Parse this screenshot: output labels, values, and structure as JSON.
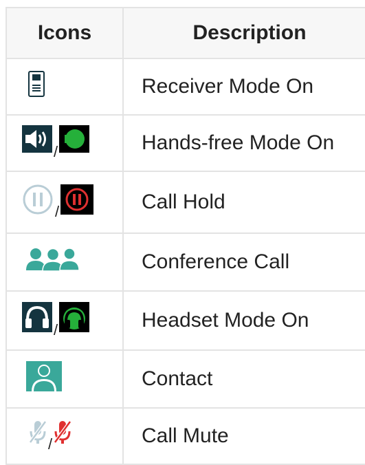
{
  "table": {
    "headers": {
      "icons": "Icons",
      "description": "Description"
    },
    "rows": [
      {
        "description": "Receiver Mode On",
        "icons": [
          "receiver-icon"
        ]
      },
      {
        "description": "Hands-free Mode On",
        "icons": [
          "speaker-icon",
          "speaker-active-icon"
        ],
        "separator": "/"
      },
      {
        "description": "Call Hold",
        "icons": [
          "pause-icon",
          "pause-active-icon"
        ],
        "separator": "/"
      },
      {
        "description": "Conference Call",
        "icons": [
          "conference-icon"
        ]
      },
      {
        "description": "Headset Mode On",
        "icons": [
          "headset-icon",
          "headset-active-icon"
        ],
        "separator": "/"
      },
      {
        "description": "Contact",
        "icons": [
          "contact-icon"
        ]
      },
      {
        "description": "Call Mute",
        "icons": [
          "mic-muted-icon",
          "mic-muted-active-icon"
        ],
        "separator": "/"
      }
    ]
  },
  "colors": {
    "header_bg": "#f7f7f7",
    "border": "#e3e3e3",
    "teal": "#3aa89a",
    "dark_navy": "#14343f",
    "green": "#25b03a",
    "red": "#e03030",
    "light_grey_blue": "#b9cdd6"
  }
}
